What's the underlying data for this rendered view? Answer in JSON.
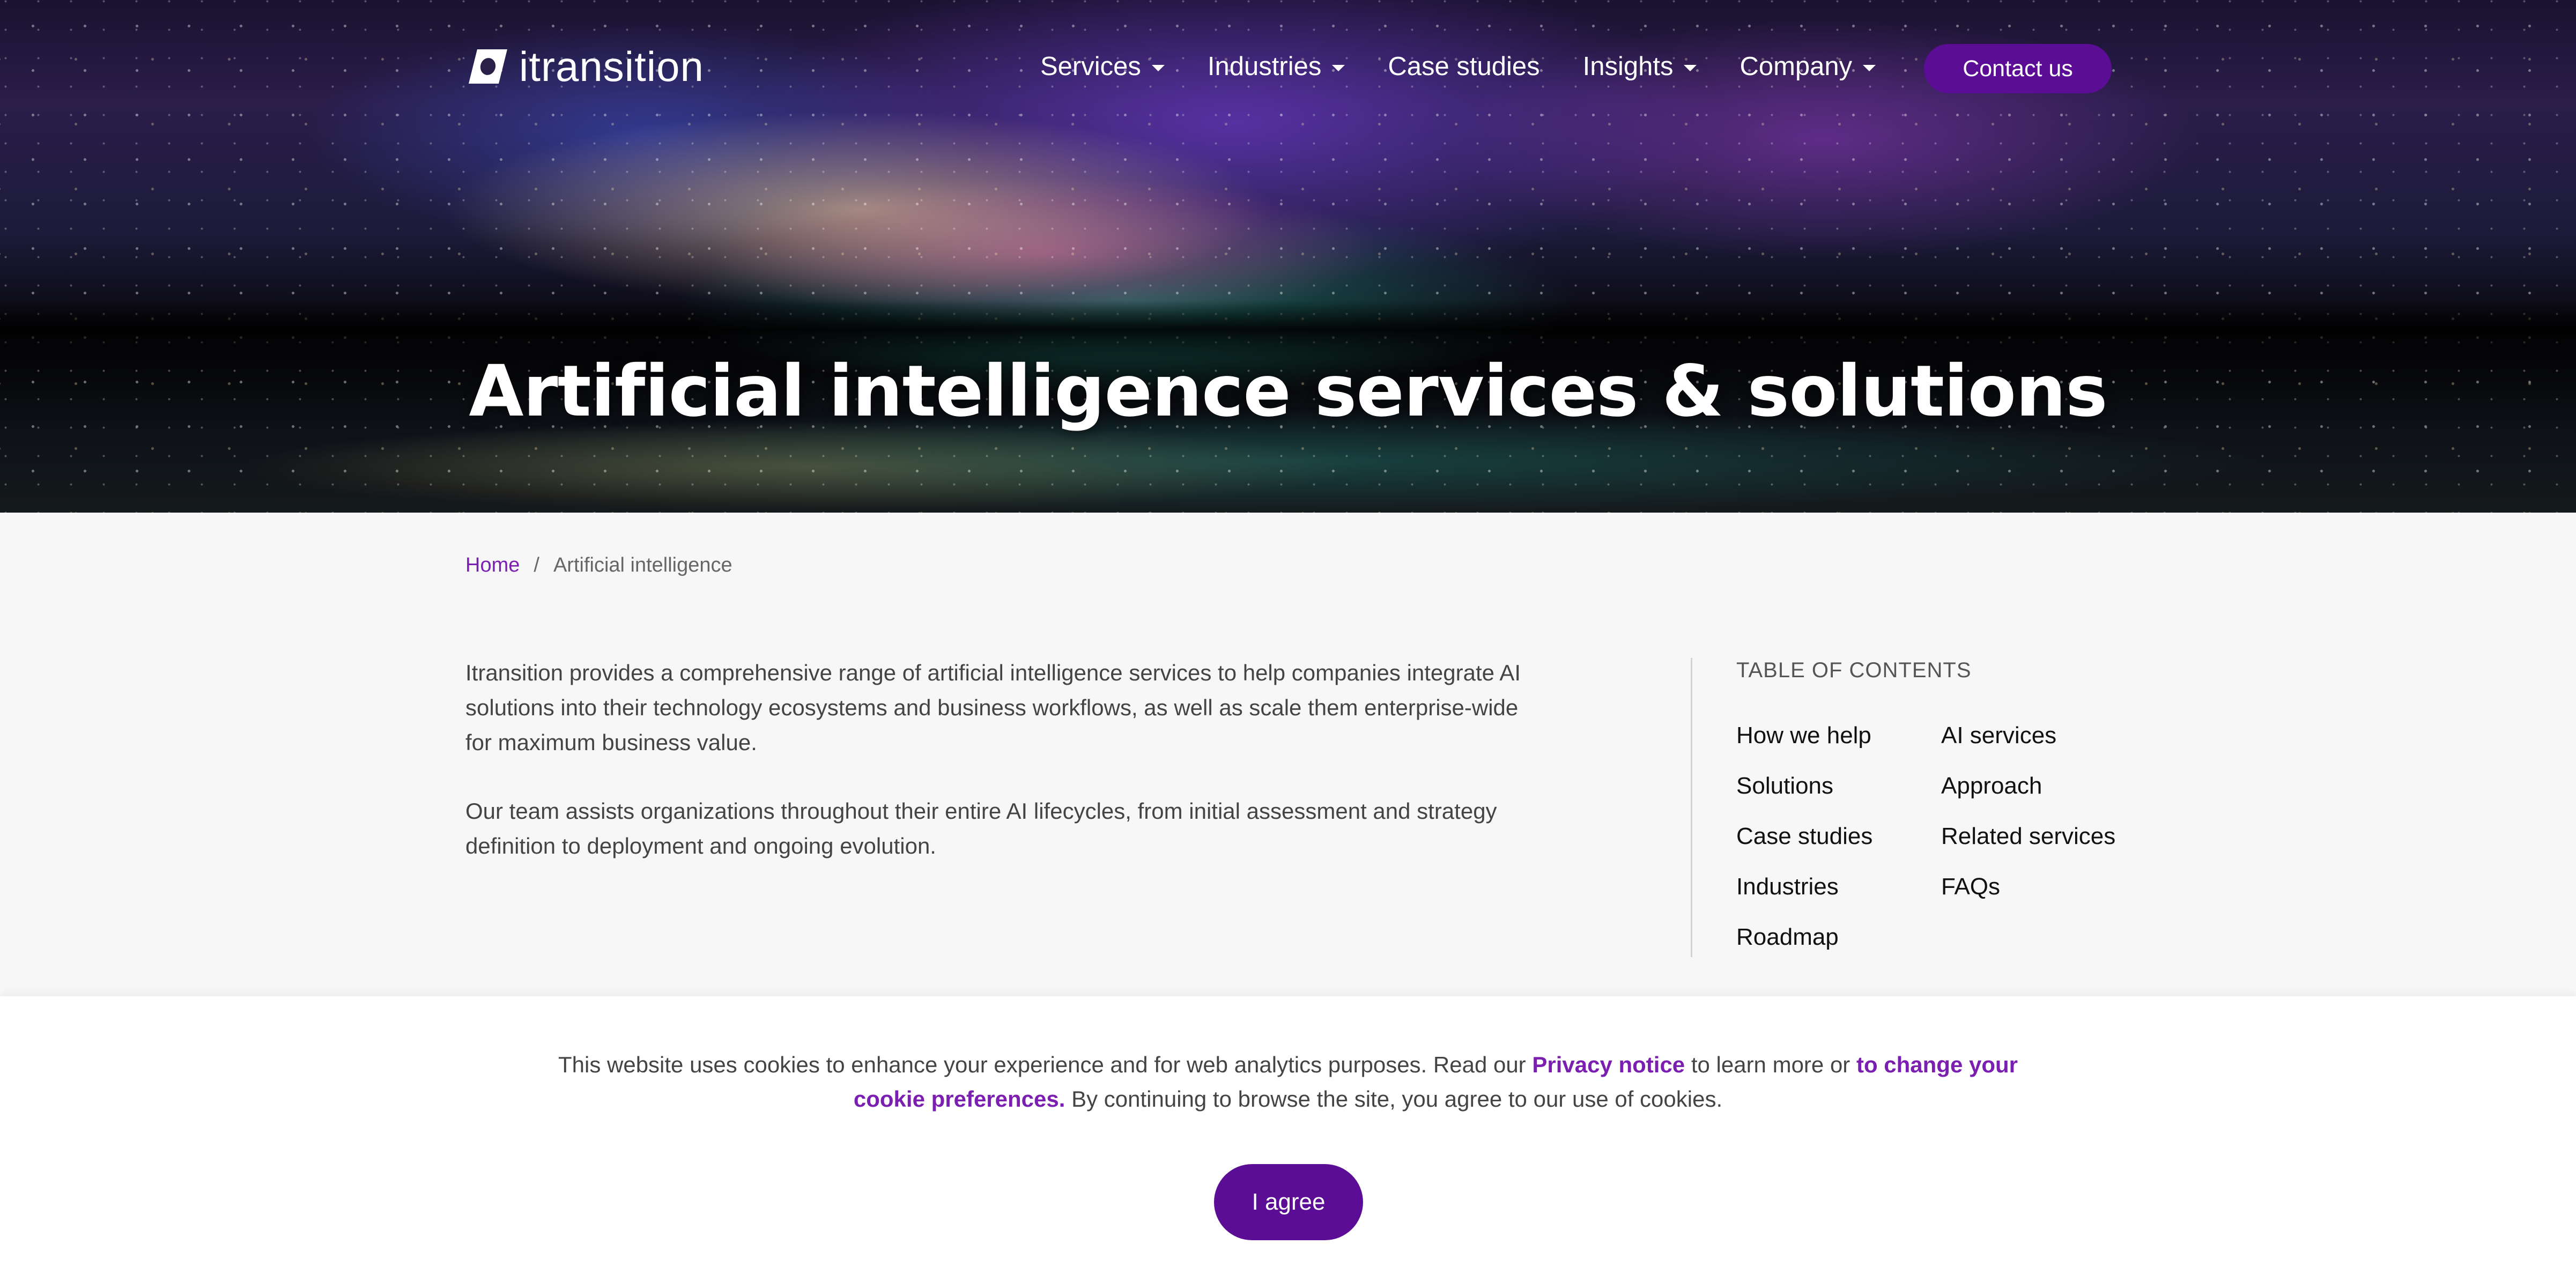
{
  "header": {
    "logo_text": "itransition",
    "nav": [
      {
        "label": "Services",
        "has_dropdown": true
      },
      {
        "label": "Industries",
        "has_dropdown": true
      },
      {
        "label": "Case studies",
        "has_dropdown": false
      },
      {
        "label": "Insights",
        "has_dropdown": true
      },
      {
        "label": "Company",
        "has_dropdown": true
      }
    ],
    "contact_label": "Contact us"
  },
  "hero": {
    "title": "Artificial intelligence services & solutions"
  },
  "breadcrumb": {
    "home": "Home",
    "separator": "/",
    "current": "Artificial intelligence"
  },
  "intro": {
    "paragraphs": [
      "Itransition provides a comprehensive range of artificial intelligence services to help companies integrate AI solutions into their technology ecosystems and business workflows, as well as scale them enterprise-wide for maximum business value.",
      "Our team assists organizations throughout their entire AI lifecycles, from initial assessment and strategy definition to deployment and ongoing evolution."
    ]
  },
  "toc": {
    "heading": "TABLE OF CONTENTS",
    "col1": [
      "How we help",
      "Solutions",
      "Case studies",
      "Industries",
      "Roadmap"
    ],
    "col2": [
      "AI services",
      "Approach",
      "Related services",
      "FAQs"
    ]
  },
  "cookie": {
    "text_1": "This website uses cookies to enhance your experience and for web analytics purposes. Read our ",
    "privacy_link": "Privacy notice",
    "text_2": " to learn more or ",
    "prefs_link": "to change your cookie preferences.",
    "text_3": " By continuing to browse the site, you agree to our use of cookies.",
    "agree_label": "I agree"
  },
  "colors": {
    "brand_purple": "#5b0d96",
    "link_purple": "#7a1fb0",
    "page_bg": "#f7f7f7"
  },
  "icons": [
    "logo-mark-icon",
    "chevron-down-icon"
  ]
}
